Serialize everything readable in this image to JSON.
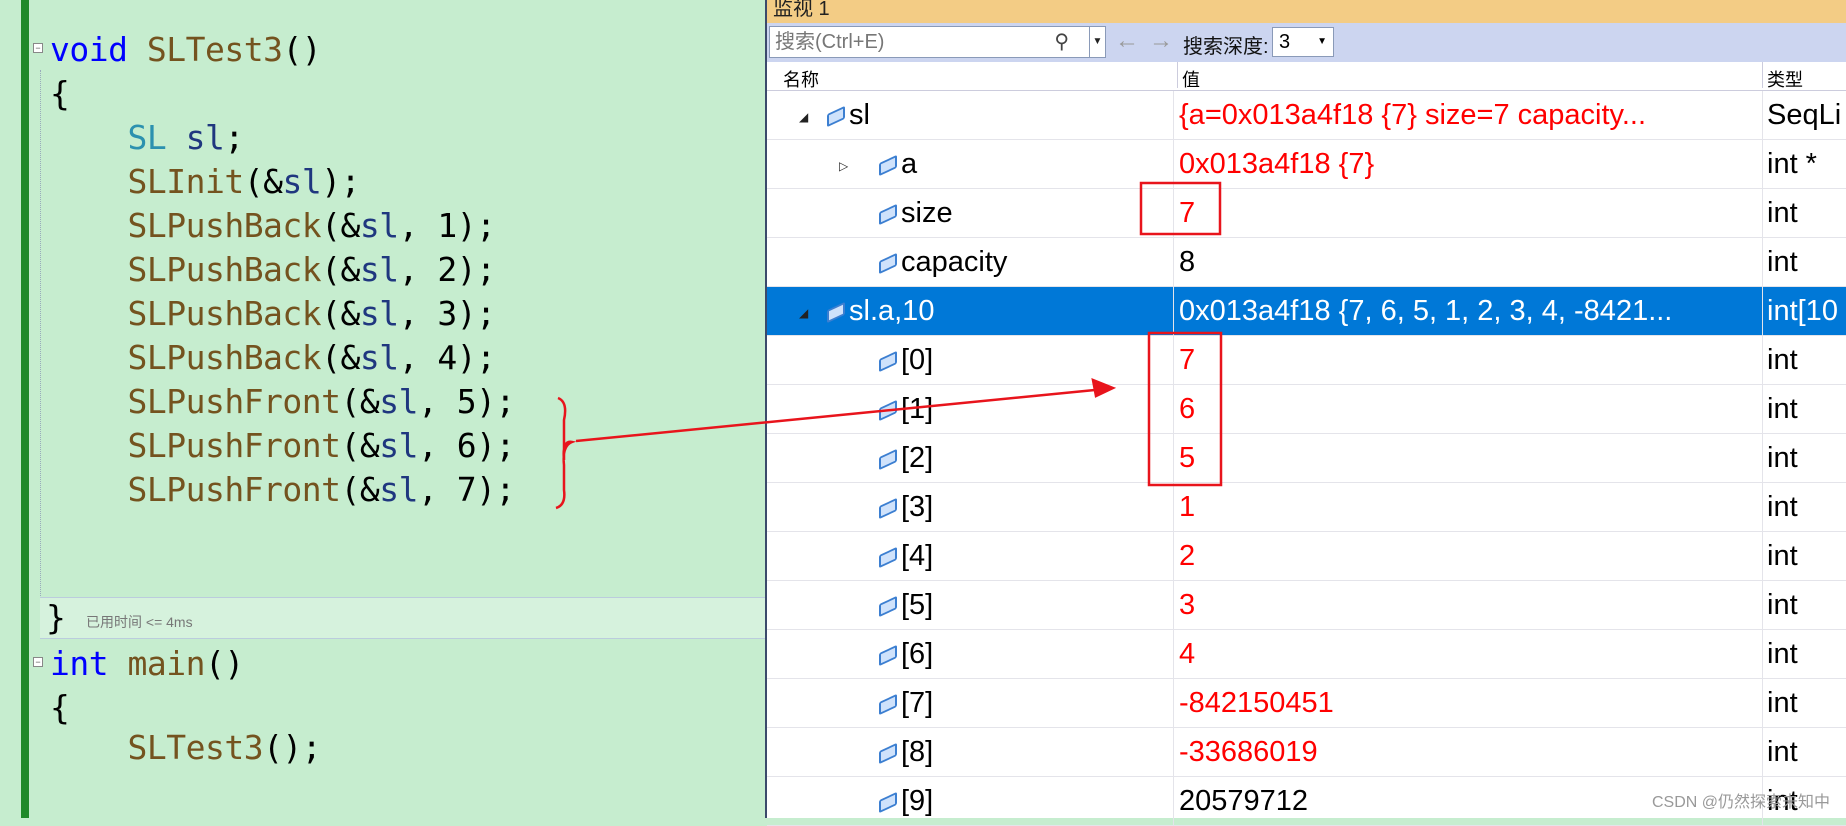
{
  "editor": {
    "lines": [
      {
        "parts": [
          [
            "kw",
            "void"
          ],
          [
            "",
            " "
          ],
          [
            "fn",
            "SLTest3"
          ],
          [
            "",
            "()"
          ]
        ]
      },
      {
        "parts": [
          [
            "",
            "{"
          ]
        ]
      },
      {
        "parts": [
          [
            "",
            "    "
          ],
          [
            "ty",
            "SL"
          ],
          [
            "",
            " "
          ],
          [
            "var",
            "sl"
          ],
          [
            "",
            ";"
          ]
        ]
      },
      {
        "parts": [
          [
            "",
            "    "
          ],
          [
            "fn",
            "SLInit"
          ],
          [
            "",
            "(&"
          ],
          [
            "var",
            "sl"
          ],
          [
            "",
            ");"
          ]
        ]
      },
      {
        "parts": [
          [
            "",
            "    "
          ],
          [
            "fn",
            "SLPushBack"
          ],
          [
            "",
            "(&"
          ],
          [
            "var",
            "sl"
          ],
          [
            "",
            ", 1);"
          ]
        ]
      },
      {
        "parts": [
          [
            "",
            "    "
          ],
          [
            "fn",
            "SLPushBack"
          ],
          [
            "",
            "(&"
          ],
          [
            "var",
            "sl"
          ],
          [
            "",
            ", 2);"
          ]
        ]
      },
      {
        "parts": [
          [
            "",
            "    "
          ],
          [
            "fn",
            "SLPushBack"
          ],
          [
            "",
            "(&"
          ],
          [
            "var",
            "sl"
          ],
          [
            "",
            ", 3);"
          ]
        ]
      },
      {
        "parts": [
          [
            "",
            "    "
          ],
          [
            "fn",
            "SLPushBack"
          ],
          [
            "",
            "(&"
          ],
          [
            "var",
            "sl"
          ],
          [
            "",
            ", 4);"
          ]
        ]
      },
      {
        "parts": [
          [
            "",
            "    "
          ],
          [
            "fn",
            "SLPushFront"
          ],
          [
            "",
            "(&"
          ],
          [
            "var",
            "sl"
          ],
          [
            "",
            ", 5);"
          ]
        ]
      },
      {
        "parts": [
          [
            "",
            "    "
          ],
          [
            "fn",
            "SLPushFront"
          ],
          [
            "",
            "(&"
          ],
          [
            "var",
            "sl"
          ],
          [
            "",
            ", 6);"
          ]
        ]
      },
      {
        "parts": [
          [
            "",
            "    "
          ],
          [
            "fn",
            "SLPushFront"
          ],
          [
            "",
            "(&"
          ],
          [
            "var",
            "sl"
          ],
          [
            "",
            ", 7);"
          ]
        ]
      }
    ],
    "closing_brace": "}",
    "elapsed_hint": "已用时间 <= 4ms",
    "main_lines": [
      {
        "parts": [
          [
            "kw",
            "int"
          ],
          [
            "",
            " "
          ],
          [
            "fn",
            "main"
          ],
          [
            "",
            "()"
          ]
        ]
      },
      {
        "parts": [
          [
            "",
            "{"
          ]
        ]
      },
      {
        "parts": [
          [
            "",
            "    "
          ],
          [
            "fn",
            "SLTest3"
          ],
          [
            "",
            "();"
          ]
        ]
      }
    ]
  },
  "watch": {
    "title": "监视 1",
    "search_placeholder": "搜索(Ctrl+E)",
    "depth_label": "搜索深度:",
    "depth_value": "3",
    "columns": {
      "name": "名称",
      "value": "值",
      "type": "类型"
    },
    "rows": [
      {
        "name": "sl",
        "value": "{a=0x013a4f18 {7} size=7 capacity...",
        "type": "SeqLi",
        "indent": 0,
        "expander": "expanded",
        "changed": true
      },
      {
        "name": "a",
        "value": "0x013a4f18 {7}",
        "type": "int *",
        "indent": 1,
        "expander": "collapsed",
        "changed": true
      },
      {
        "name": "size",
        "value": "7",
        "type": "int",
        "indent": 1,
        "changed": true
      },
      {
        "name": "capacity",
        "value": "8",
        "type": "int",
        "indent": 1,
        "changed": false
      },
      {
        "name": "sl.a,10",
        "value": "0x013a4f18 {7, 6, 5, 1, 2, 3, 4, -8421...",
        "type": "int[10",
        "indent": 0,
        "expander": "expanded",
        "selected": true
      },
      {
        "name": "[0]",
        "value": "7",
        "type": "int",
        "indent": 1,
        "changed": true
      },
      {
        "name": "[1]",
        "value": "6",
        "type": "int",
        "indent": 1,
        "changed": true
      },
      {
        "name": "[2]",
        "value": "5",
        "type": "int",
        "indent": 1,
        "changed": true
      },
      {
        "name": "[3]",
        "value": "1",
        "type": "int",
        "indent": 1,
        "changed": true
      },
      {
        "name": "[4]",
        "value": "2",
        "type": "int",
        "indent": 1,
        "changed": true
      },
      {
        "name": "[5]",
        "value": "3",
        "type": "int",
        "indent": 1,
        "changed": true
      },
      {
        "name": "[6]",
        "value": "4",
        "type": "int",
        "indent": 1,
        "changed": true
      },
      {
        "name": "[7]",
        "value": "-842150451",
        "type": "int",
        "indent": 1,
        "changed": true
      },
      {
        "name": "[8]",
        "value": "-33686019",
        "type": "int",
        "indent": 1,
        "changed": true
      },
      {
        "name": "[9]",
        "value": "20579712",
        "type": "int",
        "indent": 1,
        "changed": false
      }
    ]
  },
  "annotation_color": "#e8141c",
  "watermark": "CSDN @仍然探索未知中"
}
